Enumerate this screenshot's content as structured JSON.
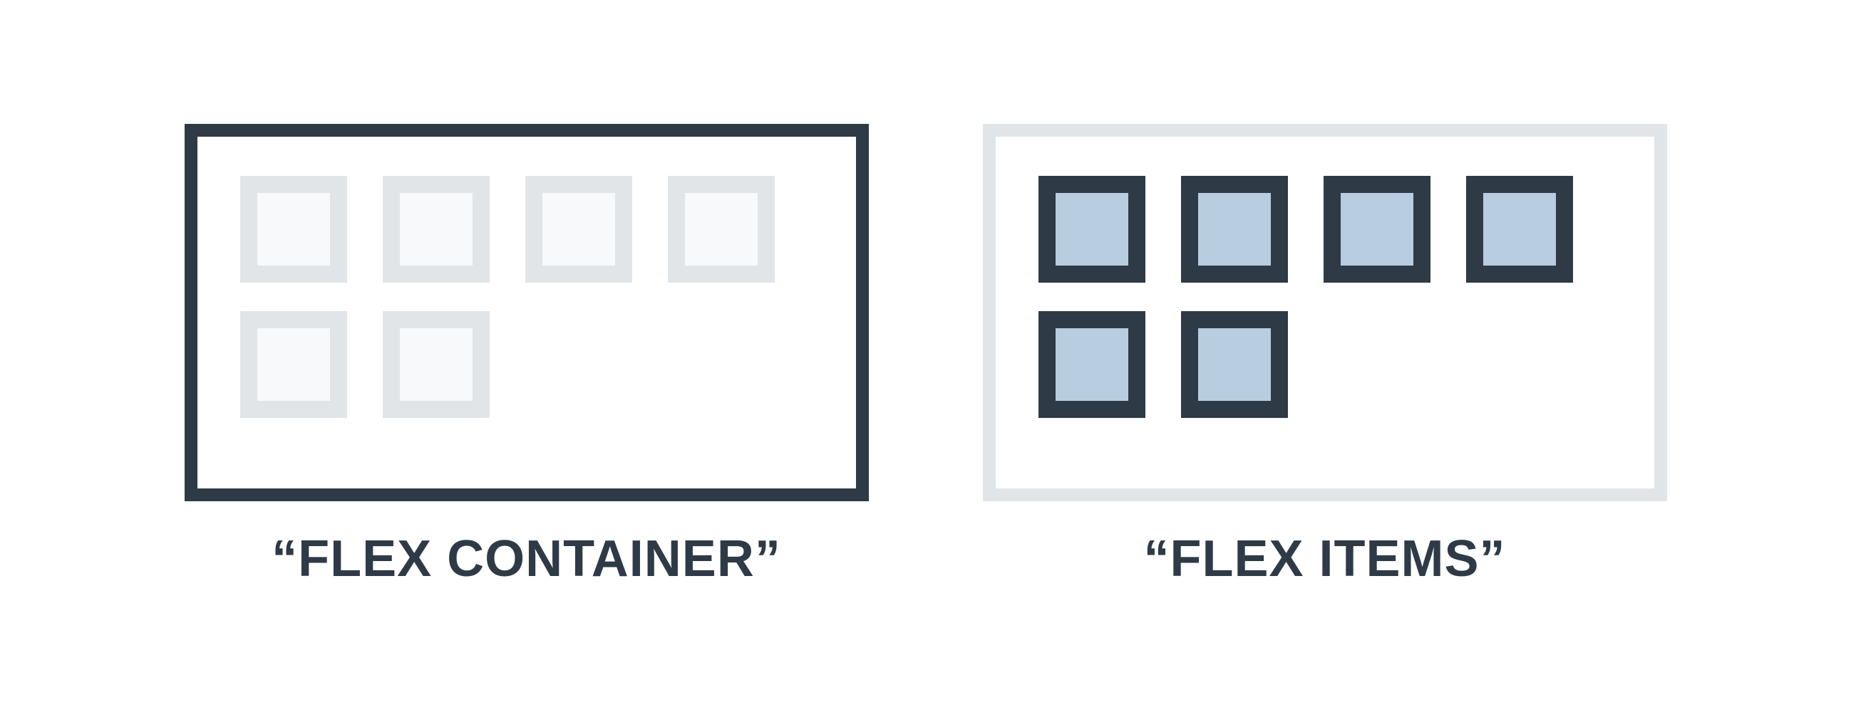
{
  "colors": {
    "dark": "#2e3a46",
    "light_border": "#e1e5e8",
    "light_fill": "#f7f9fb",
    "blue_fill": "#b8cde0"
  },
  "panels": {
    "left": {
      "label": "“FLEX CONTAINER”",
      "container_emphasis": "dark",
      "items_emphasis": "light",
      "item_count": 6
    },
    "right": {
      "label": "“FLEX ITEMS”",
      "container_emphasis": "light",
      "items_emphasis": "dark",
      "item_count": 6
    }
  }
}
